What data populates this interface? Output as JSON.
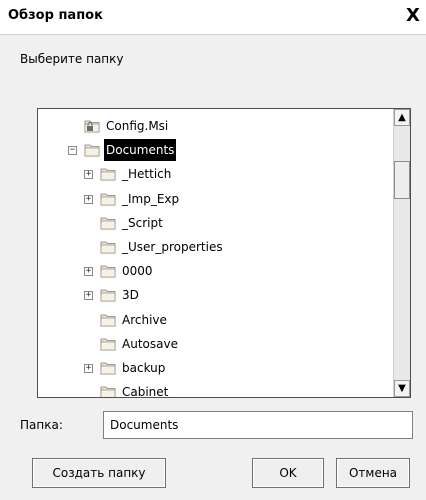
{
  "dialog": {
    "title": "Обзор папок",
    "close_glyph": "X",
    "prompt": "Выберите папку",
    "tree": [
      {
        "label": "Config.Msi",
        "expander": "",
        "icon": "locked-folder-icon",
        "selected": false
      },
      {
        "label": "Documents",
        "expander": "−",
        "icon": "folder-icon",
        "selected": true
      },
      {
        "label": "_Hettich",
        "expander": "+",
        "icon": "folder-icon",
        "selected": false
      },
      {
        "label": "_Imp_Exp",
        "expander": "+",
        "icon": "folder-icon",
        "selected": false
      },
      {
        "label": "_Script",
        "expander": "",
        "icon": "folder-icon",
        "selected": false
      },
      {
        "label": "_User_properties",
        "expander": "",
        "icon": "folder-icon",
        "selected": false
      },
      {
        "label": "0000",
        "expander": "+",
        "icon": "folder-icon",
        "selected": false
      },
      {
        "label": "3D",
        "expander": "+",
        "icon": "folder-icon",
        "selected": false
      },
      {
        "label": "Archive",
        "expander": "",
        "icon": "folder-icon",
        "selected": false
      },
      {
        "label": "Autosave",
        "expander": "",
        "icon": "folder-icon",
        "selected": false
      },
      {
        "label": "backup",
        "expander": "+",
        "icon": "folder-icon",
        "selected": false
      },
      {
        "label": "Cabinet",
        "expander": "",
        "icon": "folder-icon",
        "selected": false
      }
    ],
    "folder_label": "Папка:",
    "folder_value": "Documents",
    "buttons": {
      "new_folder": "Создать папку",
      "ok": "OK",
      "cancel": "Отмена"
    },
    "colors": {
      "selection_bg": "#000000",
      "folder_fill": "#e7e1cf"
    }
  }
}
